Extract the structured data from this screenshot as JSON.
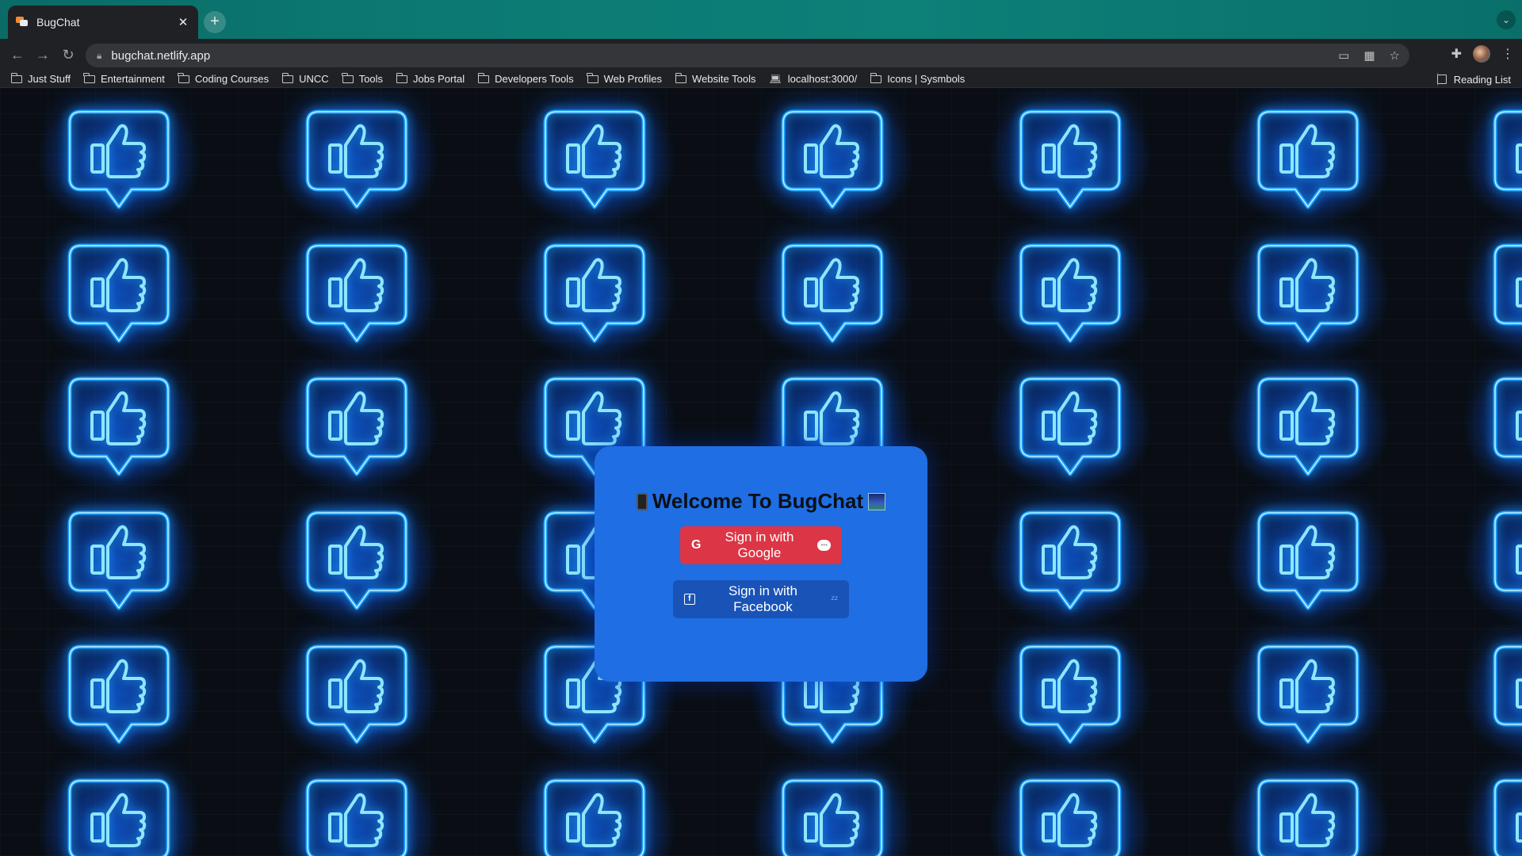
{
  "browser": {
    "tab": {
      "title": "BugChat"
    },
    "url": "bugchat.netlify.app",
    "bookmarks": [
      "Just Stuff",
      "Entertainment",
      "Coding Courses",
      "UNCC",
      "Tools",
      "Jobs Portal",
      "Developers Tools",
      "Web Profiles",
      "Website Tools",
      "localhost:3000/",
      "Icons | Sysmbols"
    ],
    "reading_list": "Reading List"
  },
  "login": {
    "title": "Welcome To BugChat",
    "google_button": "Sign in with Google",
    "facebook_button": "Sign in with Facebook"
  },
  "icons": {
    "background_tile": "neon-thumbs-up-icon",
    "google": "G",
    "facebook": "f"
  },
  "colors": {
    "card": "#1f6ee3",
    "google_button": "#dc3545",
    "facebook_button": "#1953b8",
    "neon": "#1ea0ff"
  }
}
